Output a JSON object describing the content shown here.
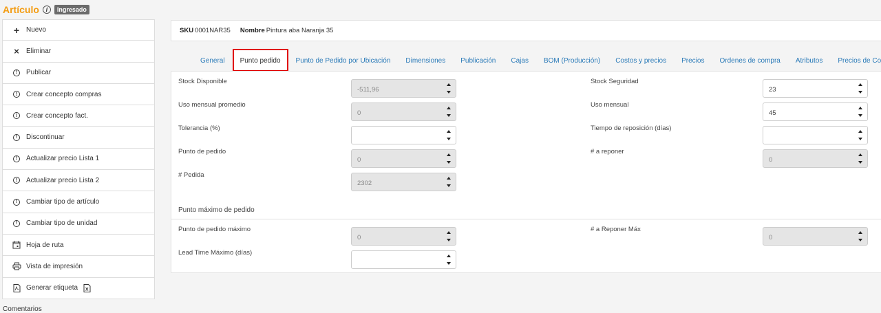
{
  "header": {
    "title": "Artículo",
    "status": "Ingresado"
  },
  "sidebar": {
    "items": [
      {
        "label": "Nuevo",
        "icon": "plus-icon"
      },
      {
        "label": "Eliminar",
        "icon": "close-icon"
      },
      {
        "label": "Publicar",
        "icon": "alert-circle-icon"
      },
      {
        "label": "Crear concepto compras",
        "icon": "alert-circle-icon"
      },
      {
        "label": "Crear concepto fact.",
        "icon": "alert-circle-icon"
      },
      {
        "label": "Discontinuar",
        "icon": "alert-circle-icon"
      },
      {
        "label": "Actualizar precio Lista 1",
        "icon": "alert-circle-icon"
      },
      {
        "label": "Actualizar precio Lista 2",
        "icon": "alert-circle-icon"
      },
      {
        "label": "Cambiar tipo de artículo",
        "icon": "alert-circle-icon"
      },
      {
        "label": "Cambiar tipo de unidad",
        "icon": "alert-circle-icon"
      },
      {
        "label": "Hoja de ruta",
        "icon": "calendar-icon"
      },
      {
        "label": "Vista de impresión",
        "icon": "printer-icon"
      },
      {
        "label": "Generar etiqueta",
        "icon": "pdf-icon"
      }
    ],
    "comments_label": "Comentarios"
  },
  "sku_bar": {
    "sku_label": "SKU",
    "sku_value": "0001NAR35",
    "name_label": "Nombre",
    "name_value": "Pintura aba Naranja 35"
  },
  "tabs": [
    {
      "label": "General",
      "active": false
    },
    {
      "label": "Punto pedido",
      "active": true
    },
    {
      "label": "Punto de Pedido por Ubicación",
      "active": false
    },
    {
      "label": "Dimensiones",
      "active": false
    },
    {
      "label": "Publicación",
      "active": false
    },
    {
      "label": "Cajas",
      "active": false
    },
    {
      "label": "BOM (Producción)",
      "active": false
    },
    {
      "label": "Costos y precios",
      "active": false
    },
    {
      "label": "Precios",
      "active": false
    },
    {
      "label": "Ordenes de compra",
      "active": false
    },
    {
      "label": "Atributos",
      "active": false
    },
    {
      "label": "Precios de Con",
      "active": false
    }
  ],
  "form": {
    "stock_disponible": {
      "label": "Stock Disponible",
      "value": "-511,96",
      "disabled": true
    },
    "uso_mensual_promedio": {
      "label": "Uso mensual promedio",
      "value": "0",
      "disabled": true
    },
    "tolerancia": {
      "label": "Tolerancia (%)",
      "value": "",
      "disabled": false
    },
    "punto_de_pedido": {
      "label": "Punto de pedido",
      "value": "0",
      "disabled": true
    },
    "pedida": {
      "label": "# Pedida",
      "value": "2302",
      "disabled": true
    },
    "stock_seguridad": {
      "label": "Stock Seguridad",
      "value": "23",
      "disabled": false
    },
    "uso_mensual": {
      "label": "Uso mensual",
      "value": "45",
      "disabled": false
    },
    "tiempo_reposicion": {
      "label": "Tiempo de reposición (días)",
      "value": "",
      "disabled": false
    },
    "a_reponer": {
      "label": "# a reponer",
      "value": "0",
      "disabled": true
    },
    "section_max_title": "Punto máximo de pedido",
    "punto_pedido_maximo": {
      "label": "Punto de pedido máximo",
      "value": "0",
      "disabled": true
    },
    "lead_time_maximo": {
      "label": "Lead Time Máximo (días)",
      "value": "",
      "disabled": false
    },
    "a_reponer_max": {
      "label": "# a Reponer Máx",
      "value": "0",
      "disabled": true
    }
  },
  "colors": {
    "accent": "#f39c12",
    "link": "#2a7ab8",
    "active_tab_border": "#e00000",
    "badge": "#6b6b6b"
  }
}
